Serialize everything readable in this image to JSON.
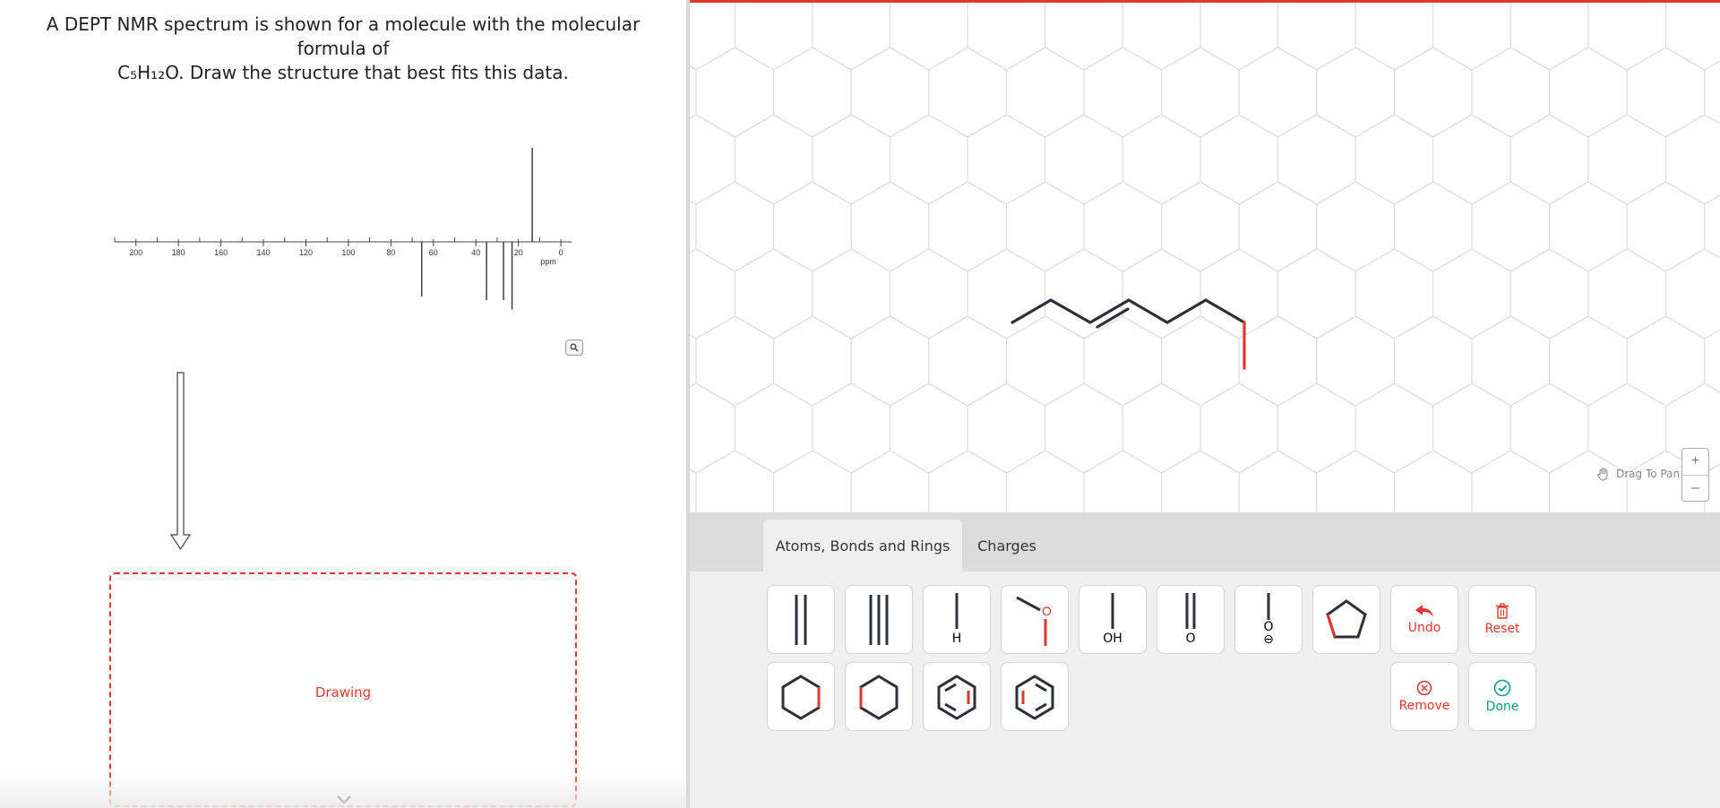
{
  "question": {
    "line1": "A DEPT NMR spectrum is shown for a molecule with the molecular formula of",
    "line2": "C₅H₁₂O. Draw the structure that best fits this data."
  },
  "spectrum": {
    "axis_ticks": [
      "200",
      "180",
      "160",
      "140",
      "120",
      "100",
      "80",
      "60",
      "40",
      "20",
      "0"
    ],
    "unit": "ppm",
    "peaks": [
      {
        "ppm": 13.5,
        "direction": "up",
        "size": 1.0
      },
      {
        "ppm": 65.5,
        "direction": "down",
        "size": 0.58
      },
      {
        "ppm": 35,
        "direction": "down",
        "size": 0.62
      },
      {
        "ppm": 27,
        "direction": "down",
        "size": 0.62
      },
      {
        "ppm": 23,
        "direction": "down",
        "size": 0.72
      }
    ]
  },
  "drawing_box": {
    "label": "Drawing"
  },
  "canvas": {
    "pan_hint": "Drag To Pan",
    "zoom_in": "+",
    "zoom_out": "–"
  },
  "tabs": [
    {
      "label": "Atoms, Bonds and Rings",
      "active": true
    },
    {
      "label": "Charges",
      "active": false
    }
  ],
  "tools": {
    "h_label": "H",
    "o_label": "O",
    "oh_label": "OH",
    "dbl_o_label": "O",
    "oxide_label": "O",
    "oxide_charge": "⊖",
    "undo": "Undo",
    "reset": "Reset",
    "remove": "Remove",
    "done": "Done"
  },
  "colors": {
    "accent": "#e2362e",
    "done": "#0f9c8c",
    "bond": "#2d3038"
  }
}
